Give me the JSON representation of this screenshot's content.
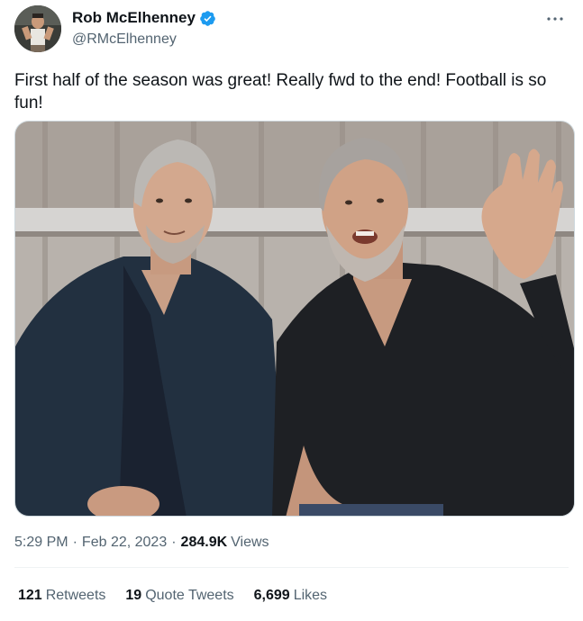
{
  "user": {
    "display_name": "Rob McElhenney",
    "handle": "@RMcElhenney",
    "verified": true,
    "verified_color": "#1d9bf0"
  },
  "tweet": {
    "text": "First half of the season was great! Really fwd to the end! Football is so fun!"
  },
  "meta": {
    "time": "5:29 PM",
    "separator": "·",
    "date": "Feb 22, 2023",
    "views_count": "284.9K",
    "views_label": "Views"
  },
  "stats": {
    "retweets_count": "121",
    "retweets_label": "Retweets",
    "quotes_count": "19",
    "quotes_label": "Quote Tweets",
    "likes_count": "6,699",
    "likes_label": "Likes"
  },
  "icons": {
    "more": "more-icon",
    "verified": "verified-badge-icon"
  }
}
